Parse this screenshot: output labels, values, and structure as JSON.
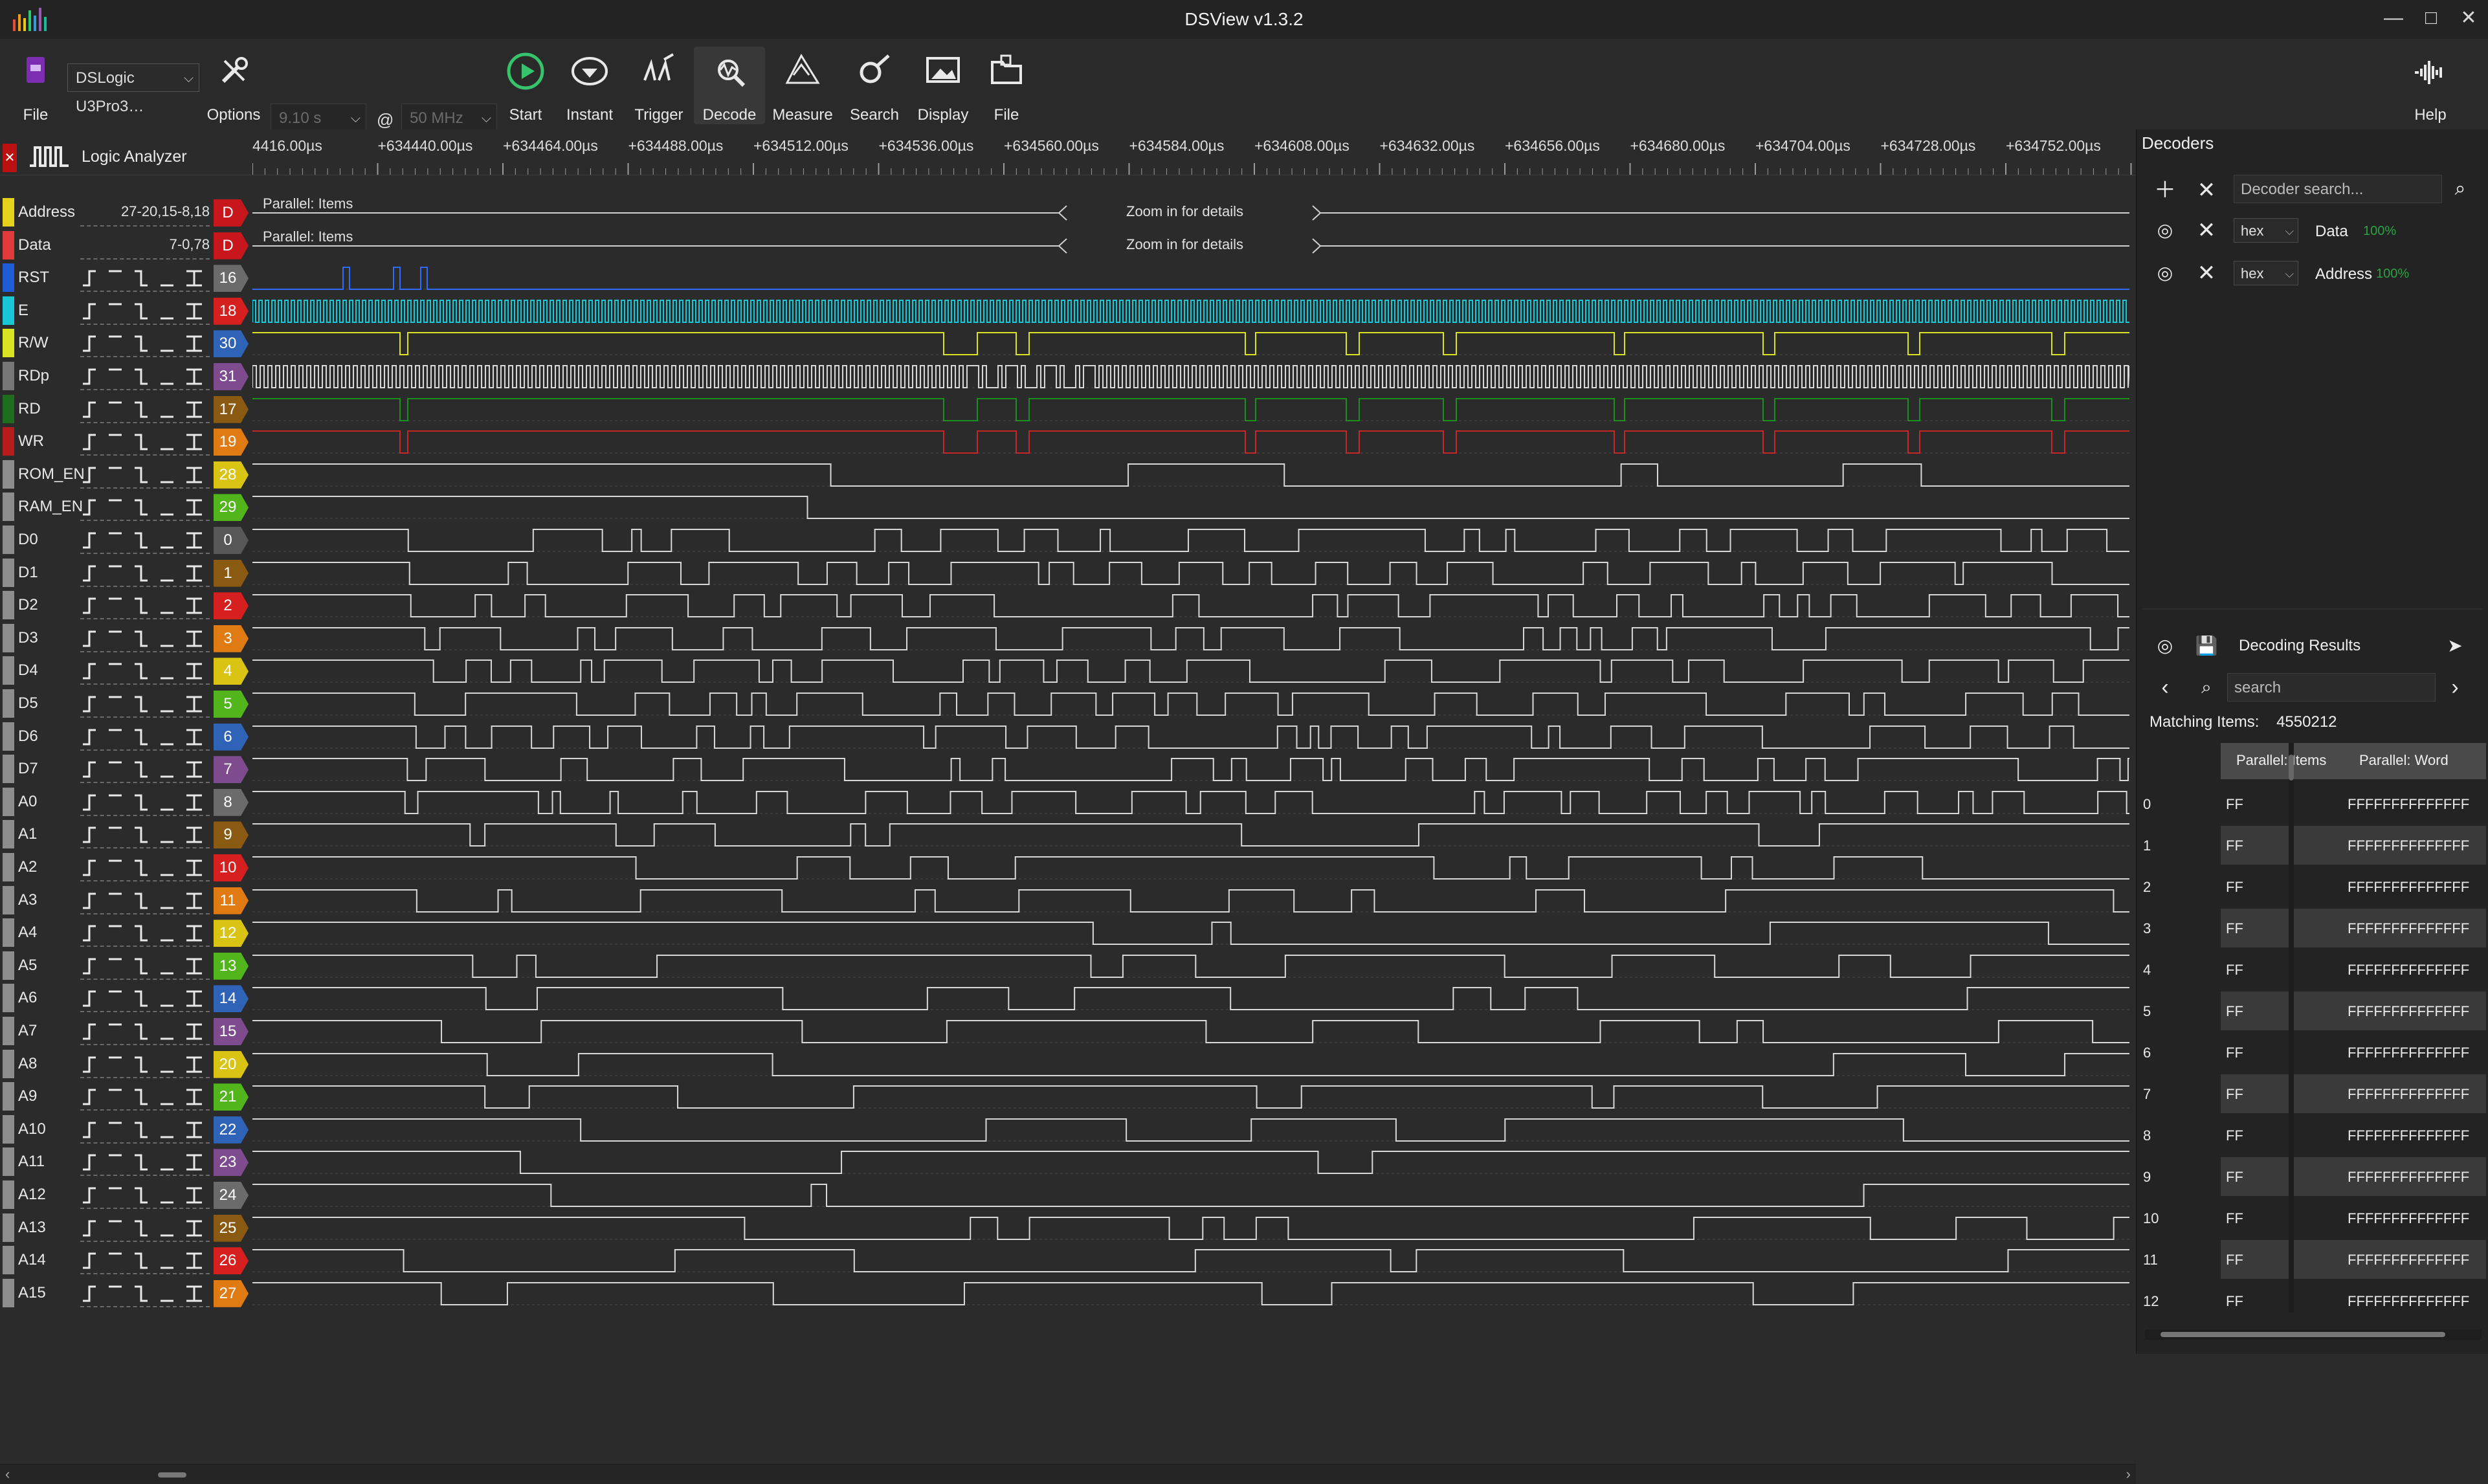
{
  "window": {
    "title": "DSView v1.3.2",
    "controls": [
      "—",
      "□",
      "✕"
    ]
  },
  "toolbar": {
    "file_label": "File",
    "device": "DSLogic U3Pro3…",
    "options_label": "Options",
    "duration": "9.10 s",
    "at": "@",
    "rate": "50 MHz",
    "start_label": "Start",
    "instant_label": "Instant",
    "trigger_label": "Trigger",
    "decode_label": "Decode",
    "measure_label": "Measure",
    "search_label": "Search",
    "display_label": "Display",
    "file2_label": "File",
    "help_label": "Help"
  },
  "ruler": {
    "labels": [
      "4416.00µs",
      "+634440.00µs",
      "+634464.00µs",
      "+634488.00µs",
      "+634512.00µs",
      "+634536.00µs",
      "+634560.00µs",
      "+634584.00µs",
      "+634608.00µs",
      "+634632.00µs",
      "+634656.00µs",
      "+634680.00µs",
      "+634704.00µs",
      "+634728.00µs",
      "+634752.00µs"
    ]
  },
  "logic": {
    "title": "Logic Analyzer"
  },
  "decoded_rows": [
    {
      "name": "Address",
      "value": "27-20,15-8,18",
      "badge": "D",
      "item": "Parallel: Items",
      "zoom": "Zoom in for details",
      "color": "#e6d21a",
      "badgeColor": "#c8161d"
    },
    {
      "name": "Data",
      "value": "7-0,78",
      "badge": "D",
      "item": "Parallel: Items",
      "zoom": "Zoom in for details",
      "color": "#e03a3a",
      "badgeColor": "#c8161d"
    }
  ],
  "channels": [
    {
      "name": "RST",
      "idx": "16",
      "color": "#1f5bd6",
      "idxColor": "#6b6b6b",
      "wave": "rst"
    },
    {
      "name": "E",
      "idx": "18",
      "color": "#19c6d6",
      "idxColor": "#d61f1f",
      "wave": "clock"
    },
    {
      "name": "R/W",
      "idx": "30",
      "color": "#d9e322",
      "idxColor": "#2f63b7",
      "wave": "rw"
    },
    {
      "name": "RDp",
      "idx": "31",
      "color": "#777777",
      "idxColor": "#7e4b8e",
      "wave": "dense"
    },
    {
      "name": "RD",
      "idx": "17",
      "color": "#1e6e1e",
      "idxColor": "#8b5a12",
      "wave": "rd"
    },
    {
      "name": "WR",
      "idx": "19",
      "color": "#b71c1c",
      "idxColor": "#e07b13",
      "wave": "wr"
    },
    {
      "name": "ROM_EN",
      "idx": "28",
      "color": "#8d8d8d",
      "idxColor": "#d9c414",
      "wave": "bus"
    },
    {
      "name": "RAM_EN",
      "idx": "29",
      "color": "#8d8d8d",
      "idxColor": "#51b51b",
      "wave": "bus2"
    },
    {
      "name": "D0",
      "idx": "0",
      "color": "#8d8d8d",
      "idxColor": "#575757",
      "wave": "data"
    },
    {
      "name": "D1",
      "idx": "1",
      "color": "#8d8d8d",
      "idxColor": "#8b5a12",
      "wave": "data"
    },
    {
      "name": "D2",
      "idx": "2",
      "color": "#8d8d8d",
      "idxColor": "#d61f1f",
      "wave": "data"
    },
    {
      "name": "D3",
      "idx": "3",
      "color": "#8d8d8d",
      "idxColor": "#e07b13",
      "wave": "data"
    },
    {
      "name": "D4",
      "idx": "4",
      "color": "#8d8d8d",
      "idxColor": "#d9c414",
      "wave": "data"
    },
    {
      "name": "D5",
      "idx": "5",
      "color": "#8d8d8d",
      "idxColor": "#51b51b",
      "wave": "data"
    },
    {
      "name": "D6",
      "idx": "6",
      "color": "#8d8d8d",
      "idxColor": "#2f63b7",
      "wave": "data"
    },
    {
      "name": "D7",
      "idx": "7",
      "color": "#8d8d8d",
      "idxColor": "#7e4b8e",
      "wave": "data"
    },
    {
      "name": "A0",
      "idx": "8",
      "color": "#8d8d8d",
      "idxColor": "#6b6b6b",
      "wave": "data"
    },
    {
      "name": "A1",
      "idx": "9",
      "color": "#8d8d8d",
      "idxColor": "#8b5a12",
      "wave": "addr"
    },
    {
      "name": "A2",
      "idx": "10",
      "color": "#8d8d8d",
      "idxColor": "#d61f1f",
      "wave": "addr"
    },
    {
      "name": "A3",
      "idx": "11",
      "color": "#8d8d8d",
      "idxColor": "#e07b13",
      "wave": "addr"
    },
    {
      "name": "A4",
      "idx": "12",
      "color": "#8d8d8d",
      "idxColor": "#d9c414",
      "wave": "addr2"
    },
    {
      "name": "A5",
      "idx": "13",
      "color": "#8d8d8d",
      "idxColor": "#51b51b",
      "wave": "addr"
    },
    {
      "name": "A6",
      "idx": "14",
      "color": "#8d8d8d",
      "idxColor": "#2f63b7",
      "wave": "addr"
    },
    {
      "name": "A7",
      "idx": "15",
      "color": "#8d8d8d",
      "idxColor": "#7e4b8e",
      "wave": "addr"
    },
    {
      "name": "A8",
      "idx": "20",
      "color": "#8d8d8d",
      "idxColor": "#d9c414",
      "wave": "bus"
    },
    {
      "name": "A9",
      "idx": "21",
      "color": "#8d8d8d",
      "idxColor": "#51b51b",
      "wave": "bus"
    },
    {
      "name": "A10",
      "idx": "22",
      "color": "#8d8d8d",
      "idxColor": "#2f63b7",
      "wave": "bus"
    },
    {
      "name": "A11",
      "idx": "23",
      "color": "#8d8d8d",
      "idxColor": "#7e4b8e",
      "wave": "bus"
    },
    {
      "name": "A12",
      "idx": "24",
      "color": "#8d8d8d",
      "idxColor": "#6b6b6b",
      "wave": "bus"
    },
    {
      "name": "A13",
      "idx": "25",
      "color": "#8d8d8d",
      "idxColor": "#8b5a12",
      "wave": "bus"
    },
    {
      "name": "A14",
      "idx": "26",
      "color": "#8d8d8d",
      "idxColor": "#d61f1f",
      "wave": "bus"
    },
    {
      "name": "A15",
      "idx": "27",
      "color": "#8d8d8d",
      "idxColor": "#e07b13",
      "wave": "bus"
    }
  ],
  "dock": {
    "decoders_title": "Decoders",
    "decoder_search_placeholder": "Decoder search...",
    "decoders": [
      {
        "format": "hex",
        "name": "Data",
        "pct": "100%"
      },
      {
        "format": "hex",
        "name": "Address",
        "pct": "100%"
      }
    ],
    "results_title": "Decoding Results",
    "search_placeholder": "search",
    "matching_label": "Matching Items:",
    "matching_count": "4550212",
    "col1": "Parallel: Items",
    "col2": "Parallel: Word",
    "rows": [
      {
        "i": "0",
        "c1": "FF",
        "c2": "FFFFFFFFFFFFFF"
      },
      {
        "i": "1",
        "c1": "FF",
        "c2": "FFFFFFFFFFFFFF"
      },
      {
        "i": "2",
        "c1": "FF",
        "c2": "FFFFFFFFFFFFFF"
      },
      {
        "i": "3",
        "c1": "FF",
        "c2": "FFFFFFFFFFFFFF"
      },
      {
        "i": "4",
        "c1": "FF",
        "c2": "FFFFFFFFFFFFFF"
      },
      {
        "i": "5",
        "c1": "FF",
        "c2": "FFFFFFFFFFFFFF"
      },
      {
        "i": "6",
        "c1": "FF",
        "c2": "FFFFFFFFFFFFFF"
      },
      {
        "i": "7",
        "c1": "FF",
        "c2": "FFFFFFFFFFFFFF"
      },
      {
        "i": "8",
        "c1": "FF",
        "c2": "FFFFFFFFFFFFFF"
      },
      {
        "i": "9",
        "c1": "FF",
        "c2": "FFFFFFFFFFFFFF"
      },
      {
        "i": "10",
        "c1": "FF",
        "c2": "FFFFFFFFFFFFFF"
      },
      {
        "i": "11",
        "c1": "FF",
        "c2": "FFFFFFFFFFFFFF"
      },
      {
        "i": "12",
        "c1": "FF",
        "c2": "FFFFFFFFFFFFFF"
      }
    ]
  }
}
